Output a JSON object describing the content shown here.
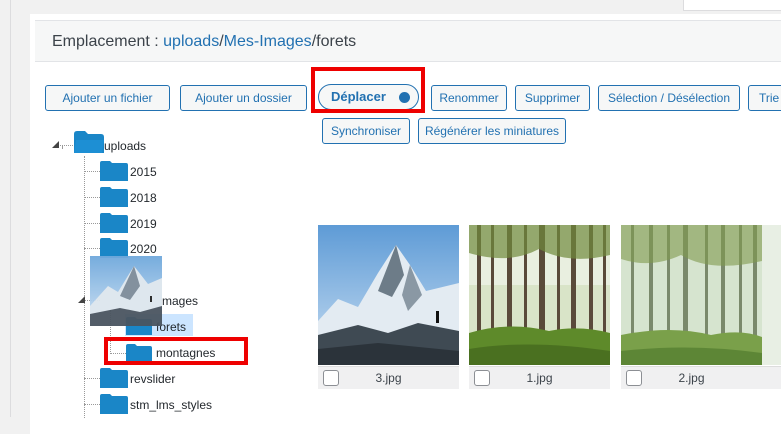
{
  "location": {
    "prefix": "Emplacement : ",
    "crumb1": "uploads",
    "sep1": "/",
    "crumb2": "Mes-Images",
    "sep2": "/",
    "current": "forets"
  },
  "toolbar": {
    "add_file": "Ajouter un fichier",
    "add_folder": "Ajouter un dossier",
    "move": "Déplacer",
    "rename": "Renommer",
    "delete": "Supprimer",
    "select": "Sélection / Désélection",
    "sort": "Trie",
    "sync": "Synchroniser",
    "regen": "Régénérer les miniatures"
  },
  "tree": {
    "root": "uploads",
    "items": [
      "2015",
      "2018",
      "2019",
      "2020",
      "mages",
      "forets",
      "montagnes",
      "revslider",
      "stm_lms_styles"
    ]
  },
  "files": [
    {
      "name": "3.jpg",
      "kind": "mountain"
    },
    {
      "name": "1.jpg",
      "kind": "forest"
    },
    {
      "name": "2.jpg",
      "kind": "forest-mist"
    }
  ],
  "colors": {
    "accent": "#2271b1",
    "folder": "#1a86c7",
    "highlight": "#e00000"
  }
}
